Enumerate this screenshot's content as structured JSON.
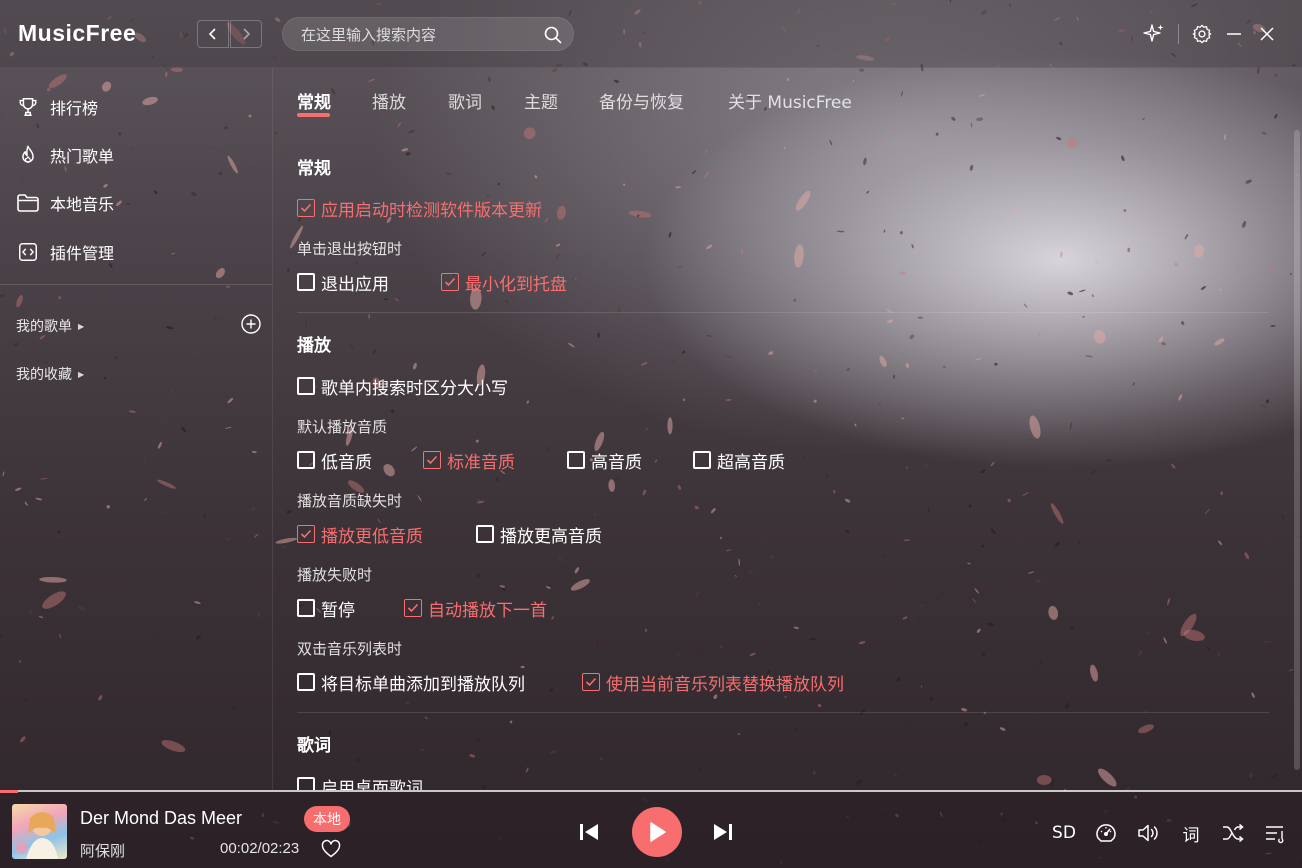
{
  "header": {
    "app_title": "MusicFree",
    "search_placeholder": "在这里输入搜索内容"
  },
  "sidebar": {
    "items": [
      {
        "label": "排行榜",
        "icon": "trophy-icon"
      },
      {
        "label": "热门歌单",
        "icon": "fire-icon"
      },
      {
        "label": "本地音乐",
        "icon": "folder-icon"
      },
      {
        "label": "插件管理",
        "icon": "plugin-icon"
      }
    ],
    "my_playlists_label": "我的歌单",
    "my_favorites_label": "我的收藏"
  },
  "tabs": [
    {
      "label": "常规",
      "active": true
    },
    {
      "label": "播放",
      "active": false
    },
    {
      "label": "歌词",
      "active": false
    },
    {
      "label": "主题",
      "active": false
    },
    {
      "label": "备份与恢复",
      "active": false
    },
    {
      "label": "关于 MusicFree",
      "active": false
    }
  ],
  "settings": {
    "general": {
      "title": "常规",
      "check_update": {
        "label": "应用启动时检测软件版本更新",
        "checked": true
      },
      "exit_button_label": "单击退出按钮时",
      "exit_options": [
        {
          "label": "退出应用",
          "checked": false
        },
        {
          "label": "最小化到托盘",
          "checked": true
        }
      ]
    },
    "playback": {
      "title": "播放",
      "case_sensitive": {
        "label": "歌单内搜索时区分大小写",
        "checked": false
      },
      "default_quality_label": "默认播放音质",
      "quality_options": [
        {
          "label": "低音质",
          "checked": false
        },
        {
          "label": "标准音质",
          "checked": true
        },
        {
          "label": "高音质",
          "checked": false
        },
        {
          "label": "超高音质",
          "checked": false
        }
      ],
      "missing_quality_label": "播放音质缺失时",
      "missing_quality_options": [
        {
          "label": "播放更低音质",
          "checked": true
        },
        {
          "label": "播放更高音质",
          "checked": false
        }
      ],
      "on_fail_label": "播放失败时",
      "on_fail_options": [
        {
          "label": "暂停",
          "checked": false
        },
        {
          "label": "自动播放下一首",
          "checked": true
        }
      ],
      "double_click_label": "双击音乐列表时",
      "double_click_options": [
        {
          "label": "将目标单曲添加到播放队列",
          "checked": false
        },
        {
          "label": "使用当前音乐列表替换播放队列",
          "checked": true
        }
      ]
    },
    "lyrics": {
      "title": "歌词",
      "desktop_lyrics": {
        "label": "启用桌面歌词",
        "checked": false
      }
    }
  },
  "player": {
    "title": "Der Mond Das Meer",
    "artist": "阿保刚",
    "source_badge": "本地",
    "time": "00:02/02:23",
    "quality": "SD",
    "lyrics_button": "词",
    "progress_fraction": 0.014
  },
  "colors": {
    "accent": "#f86e6e"
  }
}
